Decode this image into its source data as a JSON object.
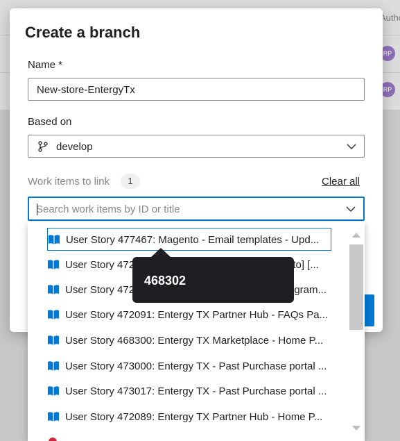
{
  "background": {
    "header_fragment": "Autho",
    "avatar_initials": [
      "RP",
      "RP"
    ]
  },
  "dialog": {
    "title": "Create a branch",
    "name_label": "Name *",
    "name_value": "New-store-EntergyTx",
    "based_on_label": "Based on",
    "based_on_value": "develop",
    "work_items_label": "Work items to link",
    "work_items_count": "1",
    "clear_all": "Clear all",
    "search_placeholder": "Search work items by ID or title"
  },
  "dropdown": {
    "items": [
      "User Story 477467: Magento - Email templates - Upd...",
      "User Story 472",
      "User Story 472",
      "User Story 472091: Entergy TX Partner Hub - FAQs Pa...",
      "User Story 468300: Entergy TX Marketplace - Home P...",
      "User Story 473000: Entergy TX - Past Purchase portal ...",
      "User Story 473017: Entergy TX - Past Purchase portal ...",
      "User Story 472089: Entergy TX Partner Hub - Home P..."
    ],
    "item_tails": [
      "nto] [...",
      "ogram..."
    ]
  },
  "tooltip": {
    "text": "468302"
  },
  "colors": {
    "accent": "#0078d4",
    "tooltip_bg": "#1f1f23",
    "avatar": "#8e6fb5"
  },
  "icons": {
    "branch": "git-branch-icon",
    "story": "book-icon",
    "chevron": "chevron-down-icon"
  }
}
